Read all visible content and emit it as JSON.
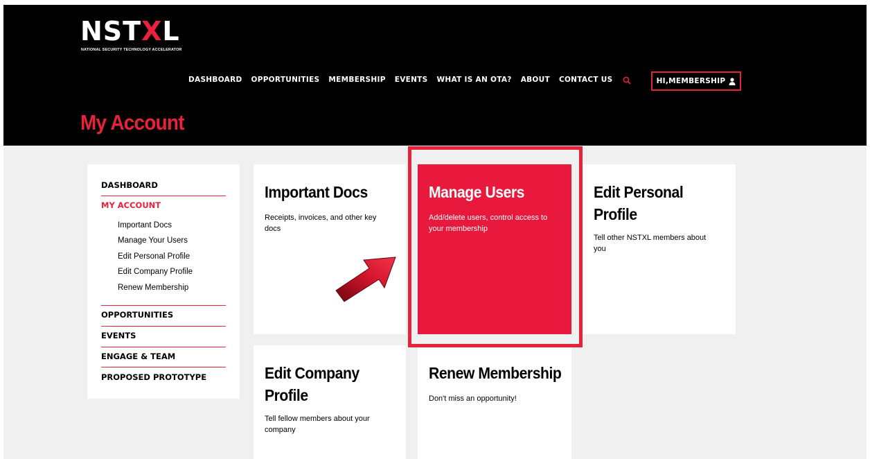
{
  "logo": {
    "mark_prefix": "NST",
    "mark_x": "X",
    "mark_suffix": "L",
    "tagline": "NATIONAL SECURITY TECHNOLOGY ACCELERATOR"
  },
  "nav": {
    "items": [
      "DASHBOARD",
      "OPPORTUNITIES",
      "MEMBERSHIP",
      "EVENTS",
      "WHAT IS AN OTA?",
      "ABOUT",
      "CONTACT US"
    ],
    "search_icon": "search-icon",
    "user_label": "HI,MEMBERSHIP",
    "user_icon": "user-icon"
  },
  "page": {
    "title": "My Account"
  },
  "sidebar": {
    "dashboard": "DASHBOARD",
    "my_account": "MY ACCOUNT",
    "sub_items": [
      "Important Docs",
      "Manage Your Users",
      "Edit Personal Profile",
      "Edit Company Profile",
      "Renew Membership"
    ],
    "opportunities": "OPPORTUNITIES",
    "events": "EVENTS",
    "engage": "ENGAGE & TEAM",
    "proposed": "PROPOSED PROTOTYPE"
  },
  "cards": {
    "important_docs": {
      "title": "Important Docs",
      "desc": "Receipts, invoices, and other key docs"
    },
    "manage_users": {
      "title": "Manage Users",
      "desc": "Add/delete users, control access to your membership"
    },
    "edit_personal": {
      "title": "Edit Personal Profile",
      "desc": "Tell other NSTXL members about you"
    },
    "edit_company": {
      "title": "Edit Company Profile",
      "desc": "Tell fellow members about your company"
    },
    "renew": {
      "title": "Renew Membership",
      "desc": "Don't miss an opportunity!"
    }
  },
  "colors": {
    "accent": "#e8213c",
    "header_bg": "#000000",
    "page_bg": "#f0f0f0"
  }
}
